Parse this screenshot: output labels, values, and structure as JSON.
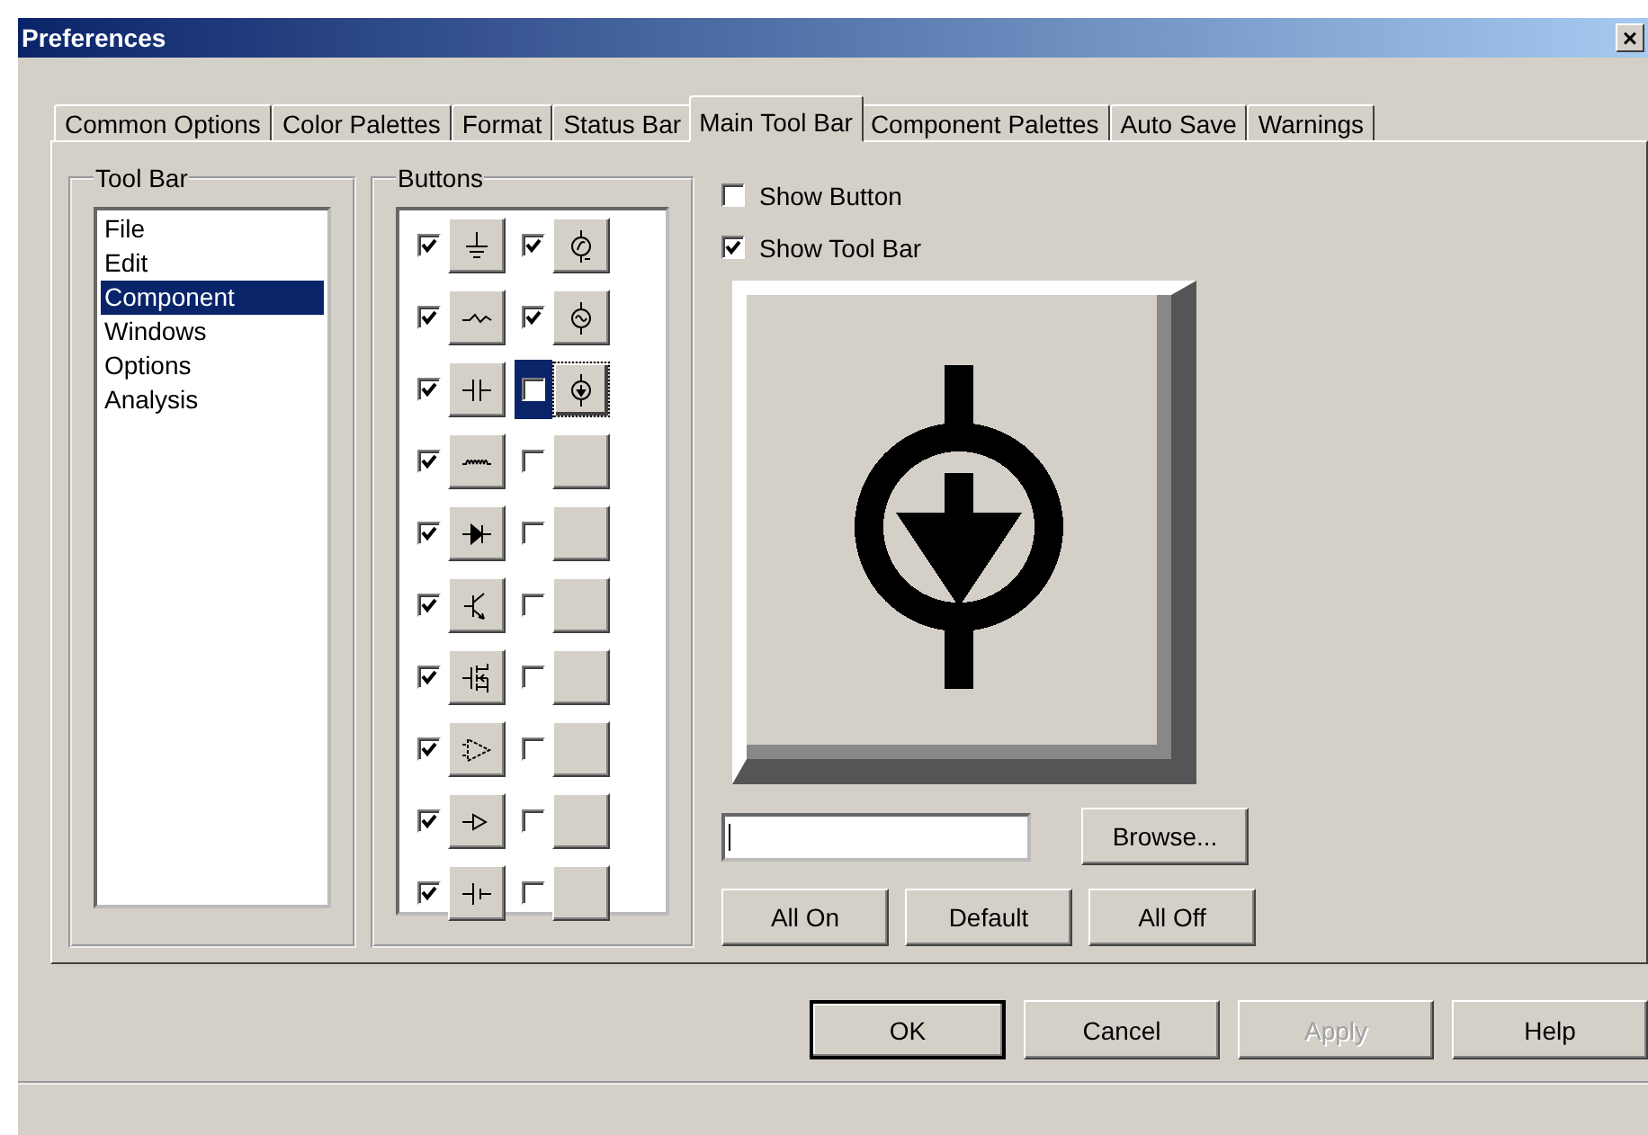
{
  "window": {
    "title": "Preferences",
    "close": "×"
  },
  "tabs": [
    {
      "label": "Common Options",
      "selected": false
    },
    {
      "label": "Color Palettes",
      "selected": false
    },
    {
      "label": "Format",
      "selected": false
    },
    {
      "label": "Status Bar",
      "selected": false
    },
    {
      "label": "Main Tool Bar",
      "selected": true
    },
    {
      "label": "Component Palettes",
      "selected": false
    },
    {
      "label": "Auto Save",
      "selected": false
    },
    {
      "label": "Warnings",
      "selected": false
    }
  ],
  "tool_bar": {
    "title": "Tool Bar",
    "items": [
      {
        "label": "File",
        "selected": false
      },
      {
        "label": "Edit",
        "selected": false
      },
      {
        "label": "Component",
        "selected": true
      },
      {
        "label": "Windows",
        "selected": false
      },
      {
        "label": "Options",
        "selected": false
      },
      {
        "label": "Analysis",
        "selected": false
      }
    ]
  },
  "buttons": {
    "title": "Buttons",
    "rows": [
      {
        "slots": [
          {
            "checked": true,
            "kind": "ground",
            "selected": false
          },
          {
            "checked": true,
            "kind": "source",
            "selected": false
          }
        ]
      },
      {
        "slots": [
          {
            "checked": true,
            "kind": "wave",
            "selected": false
          },
          {
            "checked": true,
            "kind": "sine",
            "selected": false
          }
        ]
      },
      {
        "slots": [
          {
            "checked": true,
            "kind": "capacitor",
            "selected": false
          },
          {
            "checked": false,
            "kind": "current",
            "selected": true
          }
        ]
      },
      {
        "slots": [
          {
            "checked": true,
            "kind": "inductor",
            "selected": false
          },
          {
            "checked": false,
            "kind": "empty",
            "selected": false
          }
        ]
      },
      {
        "slots": [
          {
            "checked": true,
            "kind": "diode",
            "selected": false
          },
          {
            "checked": false,
            "kind": "empty",
            "selected": false
          }
        ]
      },
      {
        "slots": [
          {
            "checked": true,
            "kind": "transistor",
            "selected": false
          },
          {
            "checked": false,
            "kind": "empty",
            "selected": false
          }
        ]
      },
      {
        "slots": [
          {
            "checked": true,
            "kind": "mosfet",
            "selected": false
          },
          {
            "checked": false,
            "kind": "empty",
            "selected": false
          }
        ]
      },
      {
        "slots": [
          {
            "checked": true,
            "kind": "amplifier",
            "selected": false
          },
          {
            "checked": false,
            "kind": "empty",
            "selected": false
          }
        ]
      },
      {
        "slots": [
          {
            "checked": true,
            "kind": "buffer",
            "selected": false
          },
          {
            "checked": false,
            "kind": "empty",
            "selected": false
          }
        ]
      },
      {
        "slots": [
          {
            "checked": true,
            "kind": "battery",
            "selected": false
          },
          {
            "checked": false,
            "kind": "empty",
            "selected": false
          }
        ]
      }
    ]
  },
  "show_button": {
    "label": "Show Button",
    "checked": false
  },
  "show_tool_bar": {
    "label": "Show Tool Bar",
    "checked": true
  },
  "browse_button": "Browse...",
  "toggle_buttons": [
    "All On",
    "Default",
    "All Off"
  ],
  "dialog_buttons": [
    {
      "label": "OK",
      "default": true,
      "disabled": false
    },
    {
      "label": "Cancel",
      "default": false,
      "disabled": false
    },
    {
      "label": "Apply",
      "default": false,
      "disabled": true
    },
    {
      "label": "Help",
      "default": false,
      "disabled": false
    }
  ]
}
